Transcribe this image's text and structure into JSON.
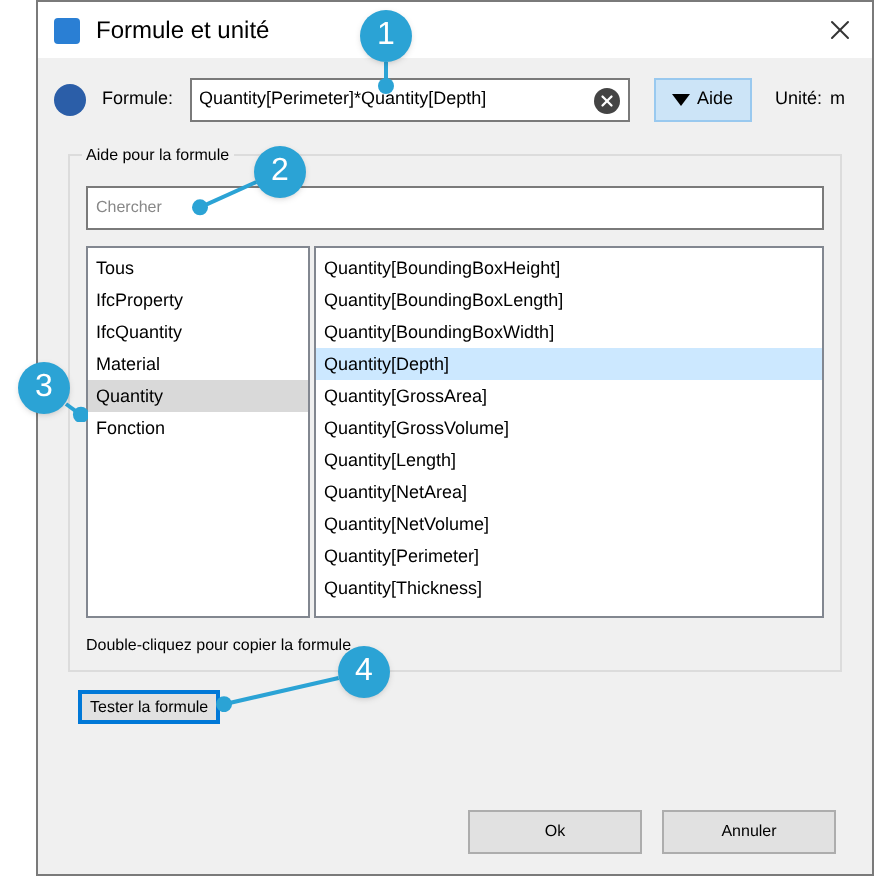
{
  "window": {
    "title": "Formule et unité"
  },
  "formula": {
    "label": "Formule:",
    "value": "Quantity[Perimeter]*Quantity[Depth]"
  },
  "help_button": {
    "label": "Aide",
    "expanded": true
  },
  "unit": {
    "label": "Unité:",
    "value": "m"
  },
  "help_group": {
    "title": "Aide pour la formule",
    "search": {
      "placeholder": "Chercher"
    },
    "categories": [
      {
        "label": "Tous",
        "selected": false
      },
      {
        "label": "IfcProperty",
        "selected": false
      },
      {
        "label": "IfcQuantity",
        "selected": false
      },
      {
        "label": "Material",
        "selected": false
      },
      {
        "label": "Quantity",
        "selected": true
      },
      {
        "label": "Fonction",
        "selected": false
      }
    ],
    "items": [
      {
        "label": "Quantity[BoundingBoxHeight]",
        "selected": false
      },
      {
        "label": "Quantity[BoundingBoxLength]",
        "selected": false
      },
      {
        "label": "Quantity[BoundingBoxWidth]",
        "selected": false
      },
      {
        "label": "Quantity[Depth]",
        "selected": true
      },
      {
        "label": "Quantity[GrossArea]",
        "selected": false
      },
      {
        "label": "Quantity[GrossVolume]",
        "selected": false
      },
      {
        "label": "Quantity[Length]",
        "selected": false
      },
      {
        "label": "Quantity[NetArea]",
        "selected": false
      },
      {
        "label": "Quantity[NetVolume]",
        "selected": false
      },
      {
        "label": "Quantity[Perimeter]",
        "selected": false
      },
      {
        "label": "Quantity[Thickness]",
        "selected": false
      }
    ],
    "hint": "Double-cliquez pour copier la formule"
  },
  "test_button": "Tester la formule",
  "buttons": [
    "Ok",
    "Annuler"
  ],
  "callouts": [
    "1",
    "2",
    "3",
    "4"
  ]
}
